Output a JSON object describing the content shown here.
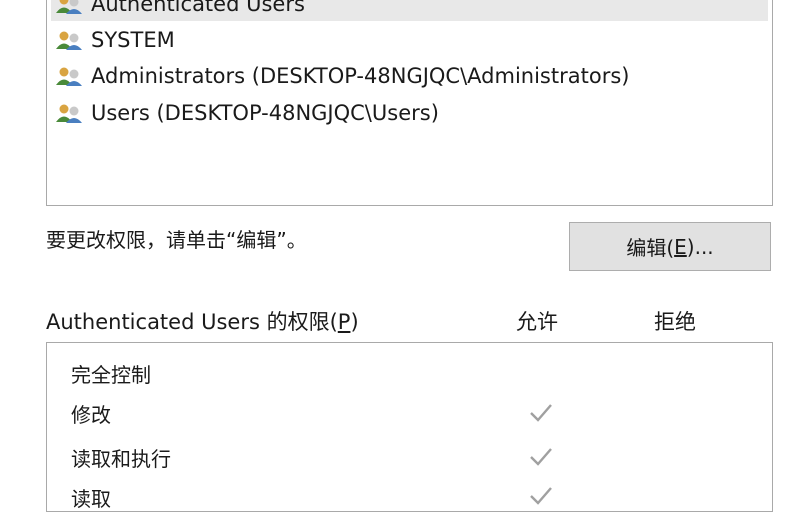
{
  "group_list": {
    "items": [
      {
        "label": "Authenticated Users",
        "icon": "user-group-icon",
        "selected": true
      },
      {
        "label": "SYSTEM",
        "icon": "user-group-icon",
        "selected": false
      },
      {
        "label": "Administrators (DESKTOP-48NGJQC\\Administrators)",
        "icon": "user-group-icon",
        "selected": false
      },
      {
        "label": "Users (DESKTOP-48NGJQC\\Users)",
        "icon": "user-group-icon",
        "selected": false
      }
    ]
  },
  "hint": {
    "text": "要更改权限，请单击“编辑”。"
  },
  "edit_button": {
    "label_before": "编辑(",
    "accel": "E",
    "label_after": ")..."
  },
  "permissions": {
    "title_before": "Authenticated Users 的权限(",
    "title_accel": "P",
    "title_after": ")",
    "allow_header": "允许",
    "deny_header": "拒绝",
    "rows": [
      {
        "label": "完全控制",
        "allow": false,
        "deny": false
      },
      {
        "label": "修改",
        "allow": true,
        "deny": false
      },
      {
        "label": "读取和执行",
        "allow": true,
        "deny": false
      },
      {
        "label": "读取",
        "allow": true,
        "deny": false
      }
    ]
  },
  "colors": {
    "check": "#a0a0a0",
    "selected_row": "#e8e8e8",
    "button_face": "#e1e1e1"
  }
}
